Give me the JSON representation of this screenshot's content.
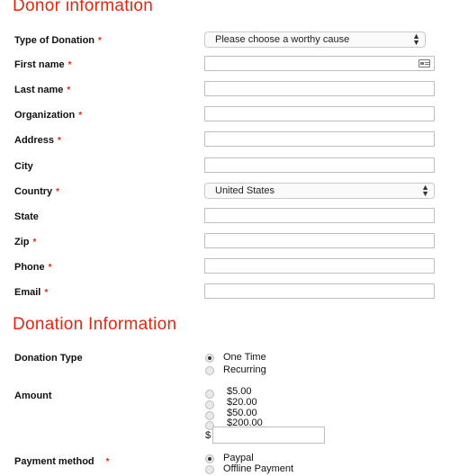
{
  "donor": {
    "title": "Donor information",
    "required_mark": "*",
    "type_of_donation": {
      "label": "Type of Donation",
      "value": "Please choose a worthy cause"
    },
    "first_name": {
      "label": "First name"
    },
    "last_name": {
      "label": "Last name"
    },
    "organization": {
      "label": "Organization"
    },
    "address": {
      "label": "Address"
    },
    "city": {
      "label": "City"
    },
    "country": {
      "label": "Country",
      "value": "United States"
    },
    "state": {
      "label": "State"
    },
    "zip": {
      "label": "Zip"
    },
    "phone": {
      "label": "Phone"
    },
    "email": {
      "label": "Email"
    }
  },
  "donation": {
    "title": "Donation Information",
    "donation_type": {
      "label": "Donation Type",
      "options": [
        "One Time",
        "Recurring"
      ],
      "selected": "One Time"
    },
    "amount": {
      "label": "Amount",
      "options": [
        "$5.00",
        "$20.00",
        "$50.00",
        "$200.00"
      ],
      "custom_prefix": "$"
    },
    "payment_method": {
      "label": "Payment method",
      "options": [
        "Paypal",
        "Offline Payment"
      ],
      "selected": "Paypal"
    }
  },
  "icons": {
    "select_arrows": "up-down-chevron-icon",
    "autofill": "contact-card-icon"
  },
  "colors": {
    "accent": "#e8260c"
  }
}
